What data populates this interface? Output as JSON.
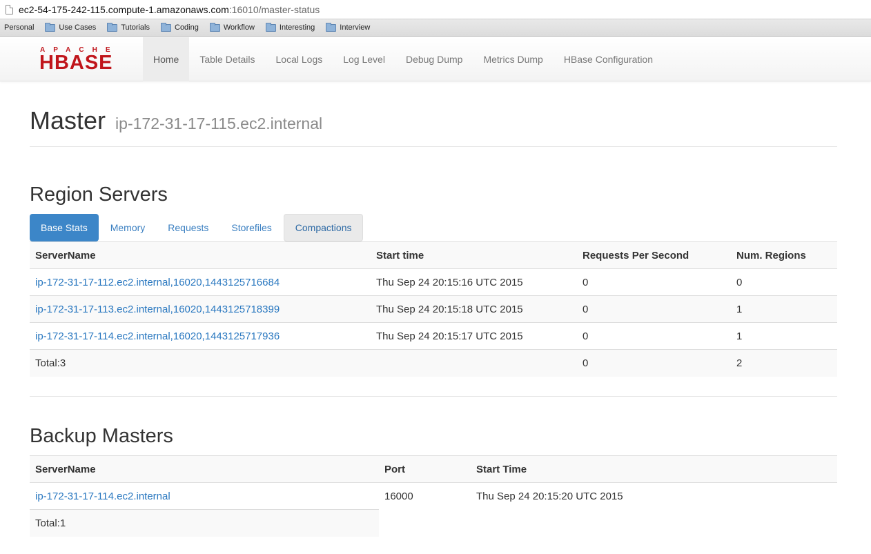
{
  "browser": {
    "url_host": "ec2-54-175-242-115.compute-1.amazonaws.com",
    "url_rest": ":16010/master-status",
    "bookmarks": [
      {
        "label": "Personal",
        "folder": false
      },
      {
        "label": "Use Cases",
        "folder": true
      },
      {
        "label": "Tutorials",
        "folder": true
      },
      {
        "label": "Coding",
        "folder": true
      },
      {
        "label": "Workflow",
        "folder": true
      },
      {
        "label": "Interesting",
        "folder": true
      },
      {
        "label": "Interview",
        "folder": true
      }
    ]
  },
  "logo": {
    "top": "APACHE",
    "main": "HBASE"
  },
  "nav": {
    "items": [
      {
        "label": "Home",
        "active": true
      },
      {
        "label": "Table Details"
      },
      {
        "label": "Local Logs"
      },
      {
        "label": "Log Level"
      },
      {
        "label": "Debug Dump"
      },
      {
        "label": "Metrics Dump"
      },
      {
        "label": "HBase Configuration"
      }
    ]
  },
  "header": {
    "title": "Master",
    "host": "ip-172-31-17-115.ec2.internal"
  },
  "region_servers": {
    "title": "Region Servers",
    "tabs": [
      {
        "label": "Base Stats",
        "state": "active"
      },
      {
        "label": "Memory"
      },
      {
        "label": "Requests"
      },
      {
        "label": "Storefiles"
      },
      {
        "label": "Compactions",
        "state": "hover"
      }
    ],
    "columns": [
      "ServerName",
      "Start time",
      "Requests Per Second",
      "Num. Regions"
    ],
    "rows": [
      [
        "ip-172-31-17-112.ec2.internal,16020,1443125716684",
        "Thu Sep 24 20:15:16 UTC 2015",
        "0",
        "0"
      ],
      [
        "ip-172-31-17-113.ec2.internal,16020,1443125718399",
        "Thu Sep 24 20:15:18 UTC 2015",
        "0",
        "1"
      ],
      [
        "ip-172-31-17-114.ec2.internal,16020,1443125717936",
        "Thu Sep 24 20:15:17 UTC 2015",
        "0",
        "1"
      ]
    ],
    "total": [
      "Total:3",
      "",
      "0",
      "2"
    ]
  },
  "backup_masters": {
    "title": "Backup Masters",
    "columns": [
      "ServerName",
      "Port",
      "Start Time"
    ],
    "rows": [
      [
        "ip-172-31-17-114.ec2.internal",
        "16000",
        "Thu Sep 24 20:15:20 UTC 2015"
      ]
    ],
    "total": "Total:1"
  },
  "colors": {
    "link": "#2a78c0",
    "active_tab": "#3c86c8",
    "logo_red": "#c0151b"
  }
}
